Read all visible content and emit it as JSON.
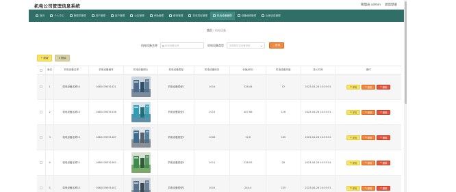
{
  "app": {
    "title": "机电公司管理信息系统",
    "user_label": "管理员 admin",
    "logout_label": "退出登录"
  },
  "nav": [
    {
      "label": "首页",
      "icon": "home-icon"
    },
    {
      "label": "个人中心",
      "icon": "user-icon"
    },
    {
      "label": "管理员管理",
      "icon": "admin-icon"
    },
    {
      "label": "用户管理",
      "icon": "users-icon"
    },
    {
      "label": "客户管理",
      "icon": "customer-icon"
    },
    {
      "label": "公告管理",
      "icon": "notice-icon"
    },
    {
      "label": "考勤管理",
      "icon": "calendar-icon"
    },
    {
      "label": "薪资管理",
      "icon": "salary-icon"
    },
    {
      "label": "机电项目管理",
      "icon": "project-icon"
    },
    {
      "label": "机电设备管理",
      "icon": "equipment-icon"
    },
    {
      "label": "设备维修管理",
      "icon": "repair-icon"
    },
    {
      "label": "出库信息管理",
      "icon": "outbound-icon"
    }
  ],
  "breadcrumb": {
    "home": "首页",
    "sep": "/",
    "current": "机电设备"
  },
  "search": {
    "name_label": "机电设备名称",
    "name_placeholder": "机电设备名称",
    "type_label": "机电设备类型",
    "type_placeholder": "请选择机电设备类型",
    "search_button": "查询"
  },
  "toolbar": {
    "add_label": "新增",
    "delete_label": "删除"
  },
  "table": {
    "headers": [
      "索引",
      "机电设备名称",
      "机电设备编号",
      "机电设备照片",
      "机电设备类型",
      "机电设备库存",
      "价格/积分",
      "机电设备热度",
      "录入时间",
      "操作"
    ],
    "rows": [
      {
        "index": "1",
        "name": "机电设备名称14",
        "code": "1682476551421",
        "type": "机电设备类型1",
        "stock": "1014",
        "price": "328.44",
        "heat": "72",
        "time": "2023-04-26 10:35:51"
      },
      {
        "index": "2",
        "name": "机电设备名称13",
        "code": "1682476551436",
        "type": "机电设备类型3",
        "stock": "1013",
        "price": "407.86",
        "heat": "116",
        "time": "2023-04-26 10:35:51"
      },
      {
        "index": "3",
        "name": "机电设备名称12",
        "code": "1682476551487",
        "type": "机电设备类型2",
        "stock": "1006",
        "price": "12.8",
        "heat": "165",
        "time": "2023-04-26 10:35:51"
      },
      {
        "index": "4",
        "name": "机电设备名称11",
        "code": "1682476551462",
        "type": "机电设备类型4",
        "stock": "1011",
        "price": "228.05",
        "heat": "28",
        "time": "2023-04-26 10:35:51"
      },
      {
        "index": "5",
        "name": "机电设备名称10",
        "code": "1682476551447",
        "type": "机电设备类型3",
        "stock": "1010",
        "price": "244.4",
        "heat": "235",
        "time": "2023-04-26 10:35:51"
      }
    ],
    "actions": {
      "detail": "详情",
      "edit": "修改",
      "remove": "删除"
    }
  },
  "colors": {
    "nav_bg": "#2f6f68",
    "accent_orange": "#f0883e",
    "accent_yellow": "#f7e36a",
    "danger": "#e2553b"
  }
}
